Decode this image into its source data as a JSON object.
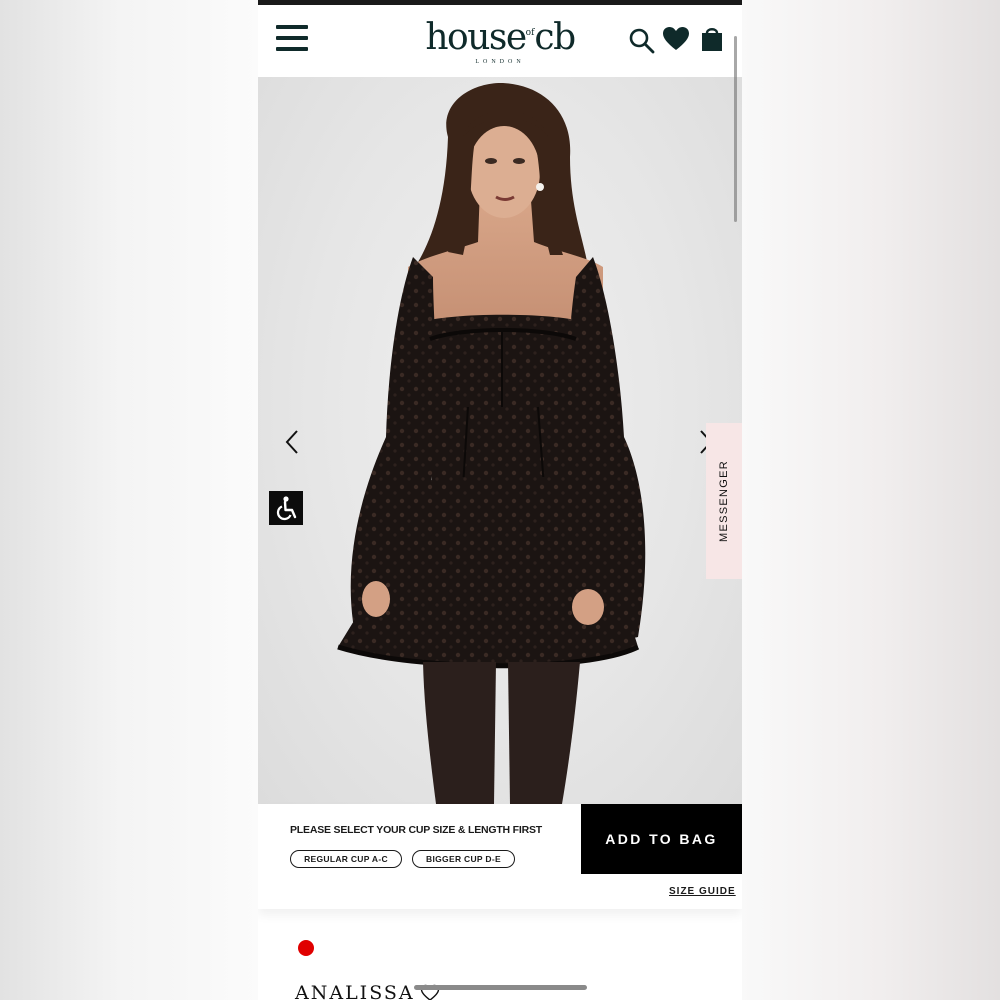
{
  "header": {
    "logo_text": "house of cb",
    "logo_word": "house",
    "logo_mark": "cb",
    "logo_sub": "LONDON",
    "menu_icon": "hamburger-menu-icon",
    "search_icon": "search-icon",
    "wishlist_icon": "heart-icon",
    "bag_icon": "shopping-bag-icon"
  },
  "gallery": {
    "prev_icon": "chevron-left-icon",
    "next_icon": "chevron-right-icon",
    "accessibility_icon": "wheelchair-accessibility-icon",
    "messenger_label": "MESSENGER"
  },
  "purchase": {
    "prompt": "PLEASE SELECT YOUR CUP SIZE & LENGTH FIRST",
    "options": [
      "REGULAR CUP A-C",
      "BIGGER CUP D-E"
    ],
    "add_to_bag": "ADD TO BAG",
    "size_guide": "SIZE GUIDE"
  },
  "product": {
    "name": "ANALISSA",
    "selected_color": "#e00000"
  },
  "colors": {
    "brand": "#0f2a2a",
    "messenger_bg": "#f7e6e6",
    "button_bg": "#000000"
  }
}
